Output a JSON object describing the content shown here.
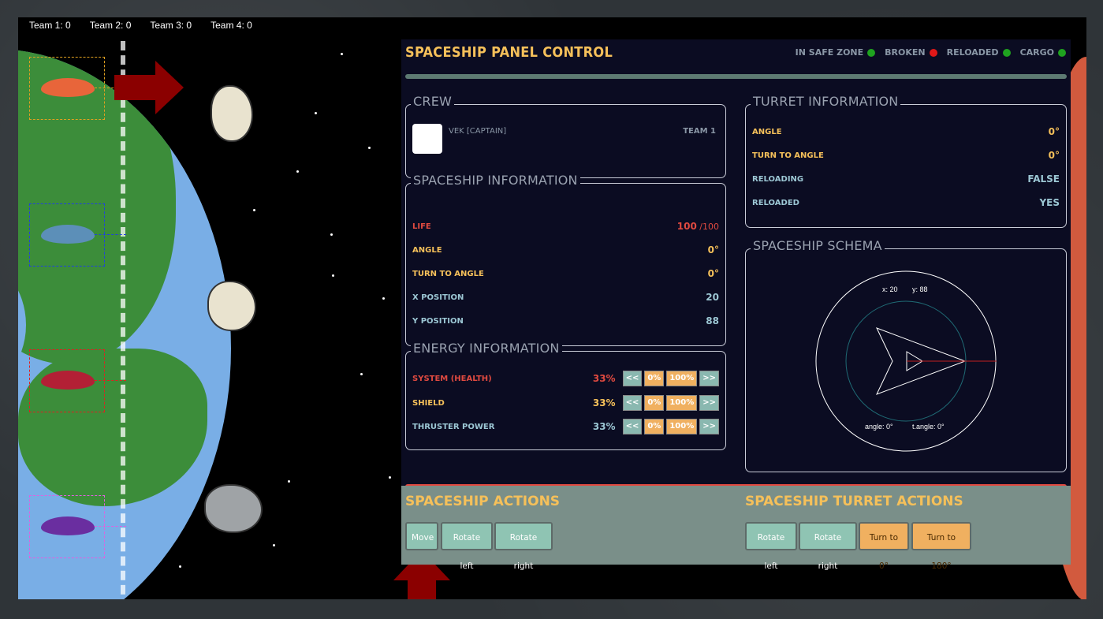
{
  "scoreboard": [
    {
      "label": "Team 1: 0"
    },
    {
      "label": "Team 2: 0"
    },
    {
      "label": "Team 3: 0"
    },
    {
      "label": "Team 4: 0"
    }
  ],
  "panel": {
    "title": "SPACESHIP PANEL CONTROL",
    "status": [
      {
        "label": "IN SAFE ZONE",
        "color": "#1fa31f"
      },
      {
        "label": "BROKEN",
        "color": "#e01818"
      },
      {
        "label": "RELOADED",
        "color": "#1fa31f"
      },
      {
        "label": "CARGO",
        "color": "#1fa31f"
      }
    ],
    "crew": {
      "title": "CREW",
      "member": "VEK [CAPTAIN]",
      "team": "TEAM 1"
    },
    "spaceship_info": {
      "title": "SPACESHIP INFORMATION",
      "life_label": "LIFE",
      "life_value": "100",
      "life_max": "/100",
      "angle_label": "ANGLE",
      "angle_value": "0°",
      "turn_label": "TURN TO ANGLE",
      "turn_value": "0°",
      "x_label": "X POSITION",
      "x_value": "20",
      "y_label": "Y POSITION",
      "y_value": "88"
    },
    "energy": {
      "title": "ENERGY INFORMATION",
      "rows": [
        {
          "label": "SYSTEM (HEALTH)",
          "value": "33%"
        },
        {
          "label": "SHIELD",
          "value": "33%"
        },
        {
          "label": "THRUSTER POWER",
          "value": "33%"
        }
      ],
      "btn_dec": "<<",
      "btn_zero": "0%",
      "btn_full": "100%",
      "btn_inc": ">>"
    },
    "turret": {
      "title": "TURRET INFORMATION",
      "angle_label": "ANGLE",
      "angle_value": "0°",
      "turn_label": "TURN TO ANGLE",
      "turn_value": "0°",
      "reloading_label": "RELOADING",
      "reloading_value": "FALSE",
      "reloaded_label": "RELOADED",
      "reloaded_value": "YES"
    },
    "schema": {
      "title": "SPACESHIP SCHEMA",
      "x": "x: 20",
      "y": "y: 88",
      "angle": "angle: 0°",
      "tangle": "t.angle: 0°"
    }
  },
  "actions": {
    "ship_title": "SPACESHIP ACTIONS",
    "move": "Move",
    "rotate_left": "Rotate left",
    "rotate_right": "Rotate right",
    "turret_title": "SPACESHIP TURRET ACTIONS",
    "t_rotate_left": "Rotate left",
    "t_rotate_right": "Rotate right",
    "turn0": "Turn to 0°",
    "turn180": "Turn to 180°"
  }
}
